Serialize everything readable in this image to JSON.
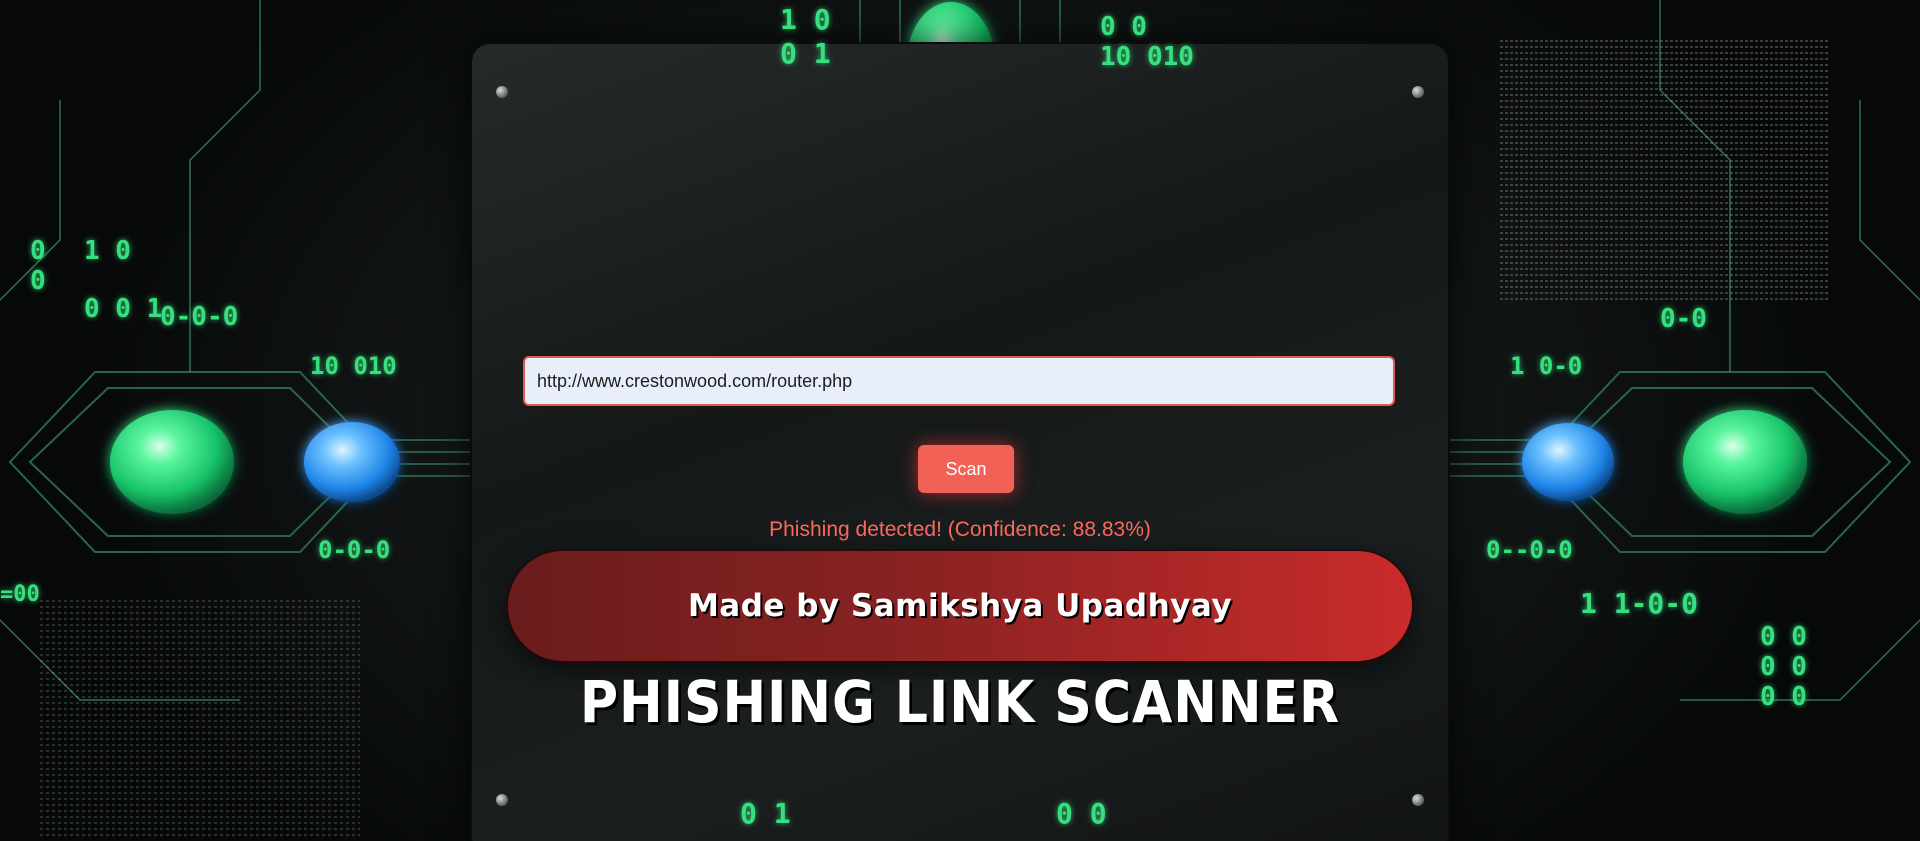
{
  "form": {
    "url_value": "http://www.crestonwood.com/router.php",
    "scan_label": "Scan"
  },
  "result": {
    "message": "Phishing detected! (Confidence: 88.83%)"
  },
  "banner": {
    "credit": "Made by Samikshya Upadhyay"
  },
  "title": "PHISHING LINK SCANNER",
  "background": {
    "digit_groups": [
      "1 0",
      "0 1",
      "0",
      "0",
      "1 0",
      "0 0",
      "0 0 1",
      "0",
      "0-0-0",
      "0",
      "10 010",
      "0-0-0",
      "=00",
      "0 1",
      "0",
      "0 0",
      "1",
      "0 0",
      "0",
      "0-0",
      "1 0-0",
      "0 0",
      "0 1",
      "0-0",
      "0--0-0",
      "0 0",
      "0 0",
      "0 1",
      "1 1-0-0",
      "0 0",
      "0 0",
      "0 0"
    ]
  },
  "colors": {
    "accent_red": "#f26155",
    "result_red": "#ff6a5c",
    "input_border": "#e05a4e",
    "input_bg": "#e8eefa",
    "circuit_green": "#37e07f",
    "node_blue": "#3aa0f5"
  }
}
